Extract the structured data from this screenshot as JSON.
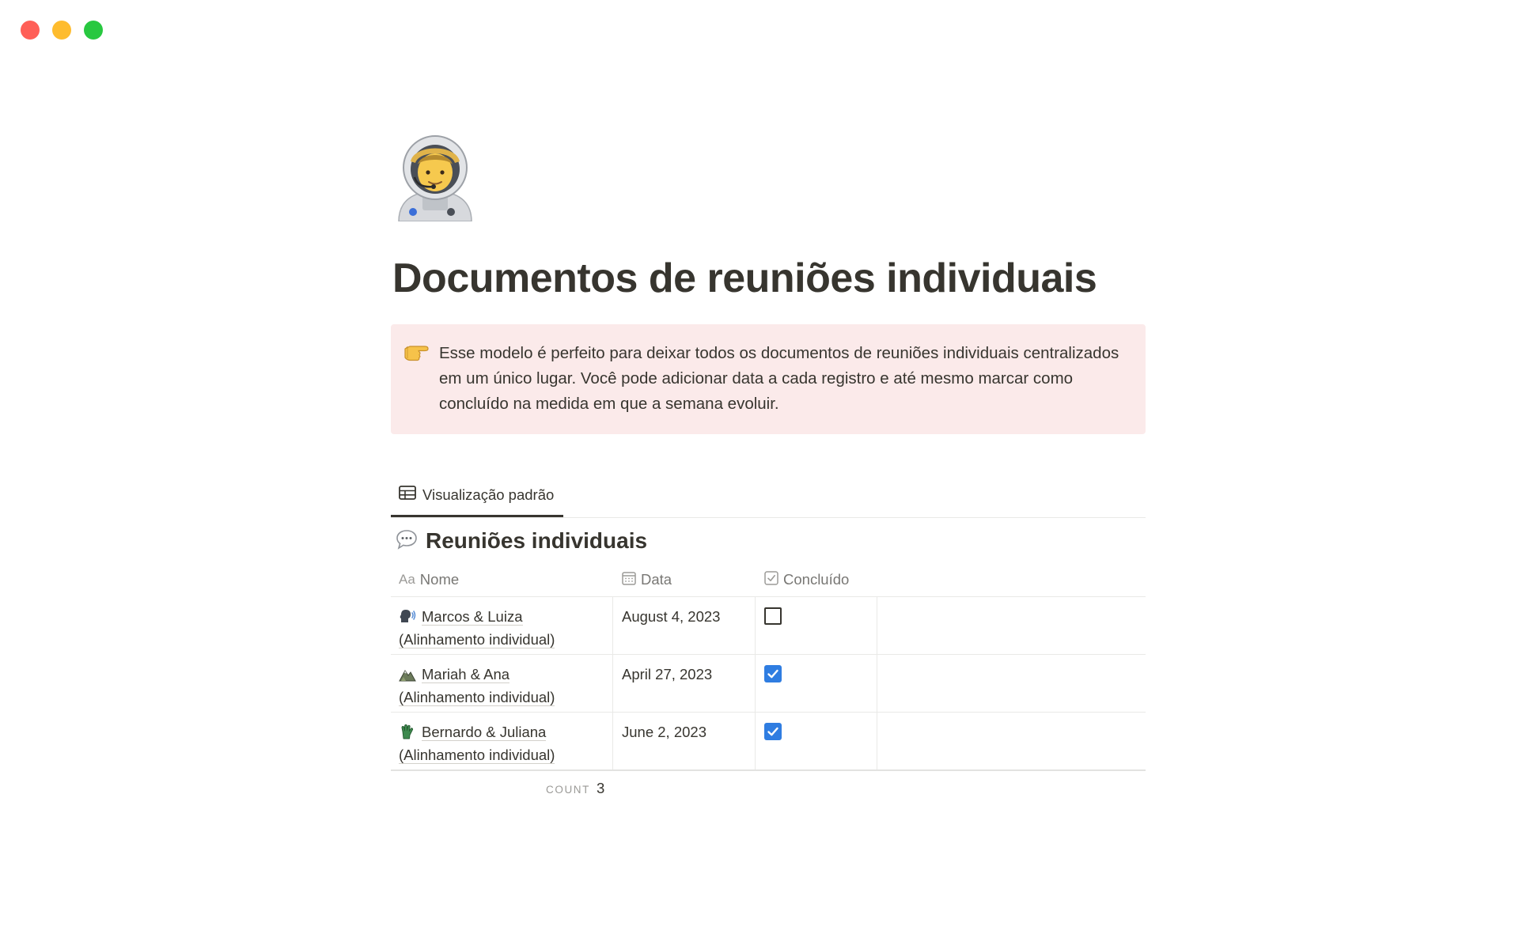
{
  "window": {
    "controls": [
      "close",
      "minimize",
      "maximize"
    ],
    "colors": {
      "close": "#ff5f57",
      "minimize": "#febc2e",
      "maximize": "#28c840"
    }
  },
  "page": {
    "icon": "astronaut-icon",
    "title": "Documentos de reuniões individuais"
  },
  "callout": {
    "icon": "pointing-right-hand-icon",
    "text": "Esse modelo é perfeito para deixar todos os documentos de reuniões individuais centralizados em um único lugar. Você pode adicionar data a cada registro e até mesmo marcar como concluído na medida em que a semana evoluir.",
    "background": "#fbeaea"
  },
  "view": {
    "tab_label": "Visualização padrão",
    "tab_icon": "table-icon"
  },
  "database": {
    "icon": "speech-bubble-icon",
    "title": "Reuniões individuais",
    "columns": {
      "name": {
        "label": "Nome",
        "icon_text": "Aa"
      },
      "date": {
        "label": "Data",
        "icon": "calendar-icon"
      },
      "done": {
        "label": "Concluído",
        "icon": "checkbox-icon"
      }
    },
    "rows": [
      {
        "icon": "speaking-head-icon",
        "name": "Marcos & Luiza",
        "subtitle": "(Alinhamento individual)",
        "date": "August 4, 2023",
        "done": false
      },
      {
        "icon": "mountain-icon",
        "name": "Mariah & Ana",
        "subtitle": "(Alinhamento individual)",
        "date": "April 27, 2023",
        "done": true
      },
      {
        "icon": "raised-hand-icon",
        "name": "Bernardo & Juliana",
        "subtitle": "(Alinhamento individual)",
        "date": "June 2, 2023",
        "done": true
      }
    ],
    "footer": {
      "count_label": "COUNT",
      "count_value": "3"
    }
  }
}
